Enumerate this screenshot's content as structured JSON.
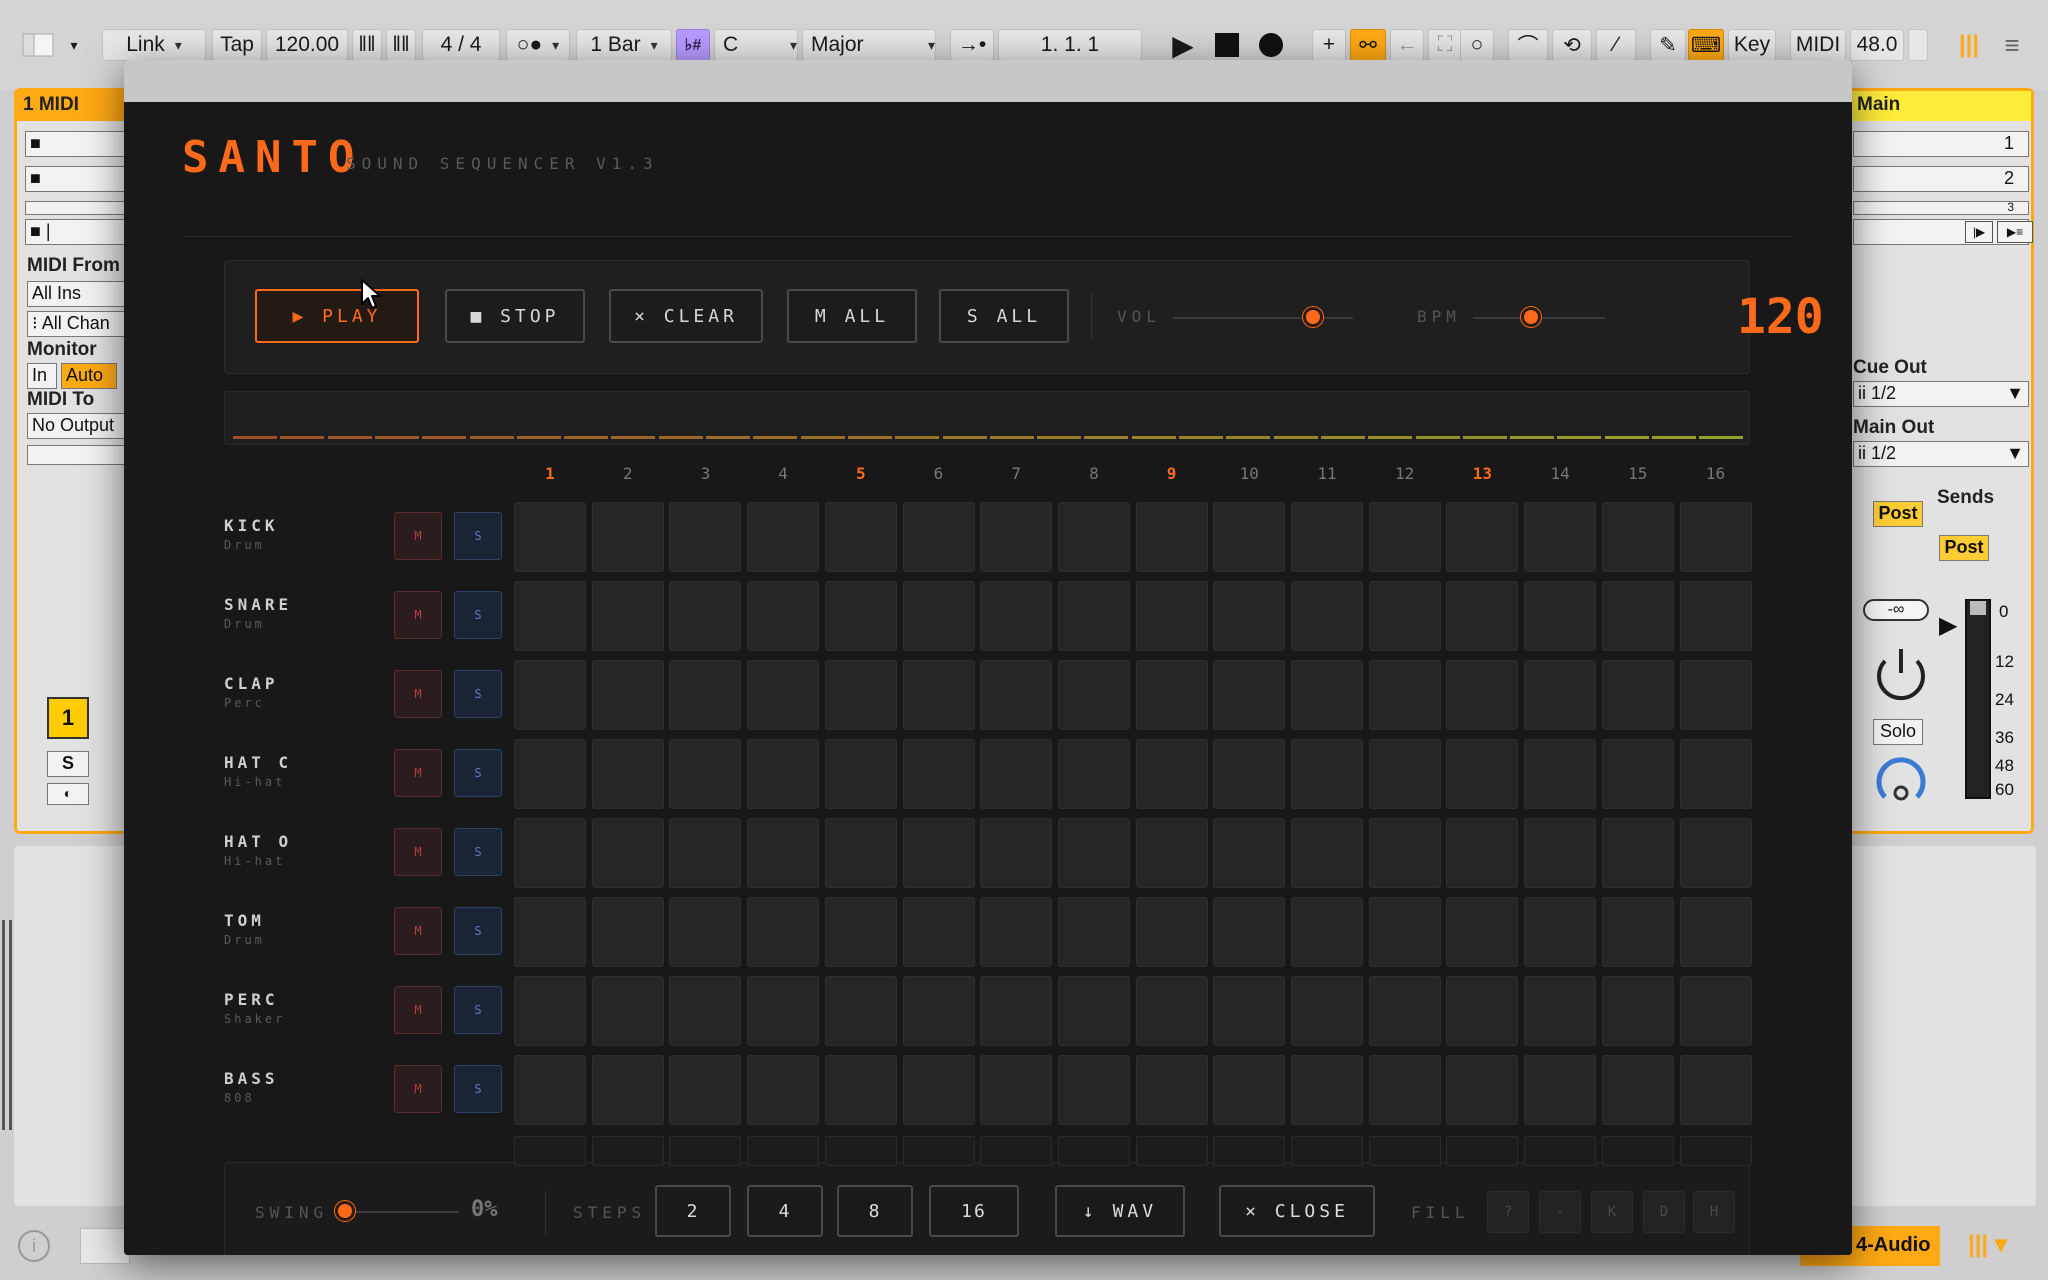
{
  "ableton": {
    "topbar": {
      "link": "Link",
      "tap": "Tap",
      "tempo": "120.00",
      "time_sig": "4 / 4",
      "quantize": "1 Bar",
      "root_key": "C",
      "scale": "Major",
      "position": "1.   1.   1",
      "key": "Key",
      "midi": "MIDI",
      "cpu": "48.0"
    },
    "left_track": {
      "title": "1 MIDI",
      "midi_from_label": "MIDI From",
      "midi_from_value": "All Ins",
      "channel_value": "All Chan",
      "monitor_label": "Monitor",
      "monitor_in": "In",
      "monitor_auto": "Auto",
      "midi_to_label": "MIDI To",
      "midi_to_value": "No Output",
      "track_number": "1",
      "solo": "S"
    },
    "main_track": {
      "title": "Main",
      "slot1": "1",
      "slot2": "2",
      "slot3": "3",
      "cue_out_label": "Cue Out",
      "cue_out_value": "ii 1/2",
      "main_out_label": "Main Out",
      "main_out_value": "ii 1/2",
      "post1": "Post",
      "sends_label": "Sends",
      "post2": "Post",
      "inf": "-∞",
      "solo": "Solo",
      "meter_marks": [
        "0",
        "12",
        "24",
        "36",
        "48",
        "60"
      ]
    },
    "status": {
      "track_name": "4-Audio"
    }
  },
  "santo": {
    "logo": "SANTO",
    "subtitle": "SOUND SEQUENCER V1.3",
    "transport": {
      "play": "▶ PLAY",
      "stop": "■ STOP",
      "clear": "× CLEAR",
      "mute_all": "M ALL",
      "solo_all": "S ALL",
      "vol_label": "VOL",
      "bpm_label": "BPM",
      "bpm_value": "120",
      "vol_level": 0.78,
      "bpm_level": 0.44
    },
    "step_numbers": [
      "1",
      "2",
      "3",
      "4",
      "5",
      "6",
      "7",
      "8",
      "9",
      "10",
      "11",
      "12",
      "13",
      "14",
      "15",
      "16"
    ],
    "accent_steps": [
      "1",
      "5",
      "9",
      "13"
    ],
    "tracks": [
      {
        "name": "KICK",
        "type": "Drum",
        "mute": "M",
        "solo": "S"
      },
      {
        "name": "SNARE",
        "type": "Drum",
        "mute": "M",
        "solo": "S"
      },
      {
        "name": "CLAP",
        "type": "Perc",
        "mute": "M",
        "solo": "S"
      },
      {
        "name": "HAT C",
        "type": "Hi-hat",
        "mute": "M",
        "solo": "S"
      },
      {
        "name": "HAT O",
        "type": "Hi-hat",
        "mute": "M",
        "solo": "S"
      },
      {
        "name": "TOM",
        "type": "Drum",
        "mute": "M",
        "solo": "S"
      },
      {
        "name": "PERC",
        "type": "Shaker",
        "mute": "M",
        "solo": "S"
      },
      {
        "name": "BASS",
        "type": "808",
        "mute": "M",
        "solo": "S"
      }
    ],
    "bottom": {
      "swing_label": "SWING",
      "swing_value": "0%",
      "steps_label": "STEPS",
      "step_options": [
        "2",
        "4",
        "8",
        "16"
      ],
      "wav": "↓ WAV",
      "close": "× CLOSE",
      "fill_label": "FILL",
      "fill_buttons": [
        "?",
        "-",
        "K",
        "D",
        "H"
      ]
    },
    "colors": {
      "accent": "#ff6a1a",
      "background": "#181818",
      "mute": "#b04040",
      "solo": "#5a7bc0"
    }
  }
}
